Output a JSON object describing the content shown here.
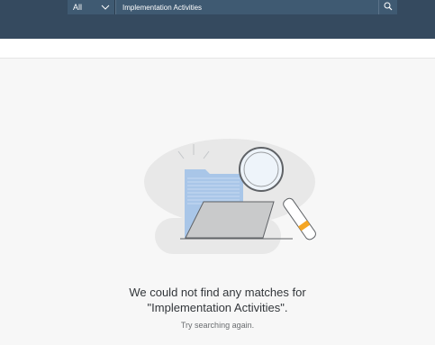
{
  "search": {
    "scope_value": "All",
    "query": "Implementation Activities"
  },
  "empty_state": {
    "line1": "We could not find any matches for",
    "line2": "\"Implementation Activities\".",
    "hint": "Try searching again."
  },
  "icons": {
    "scope_dropdown": "chevron-down-icon",
    "search": "search-icon",
    "illustration": "no-results-illustration"
  },
  "colors": {
    "header_bg": "#354a5f",
    "field_bg": "#3f5a72",
    "page_bg": "#f7f7f7",
    "folder_blue": "#a9c6e8",
    "accent": "#f5a623"
  }
}
